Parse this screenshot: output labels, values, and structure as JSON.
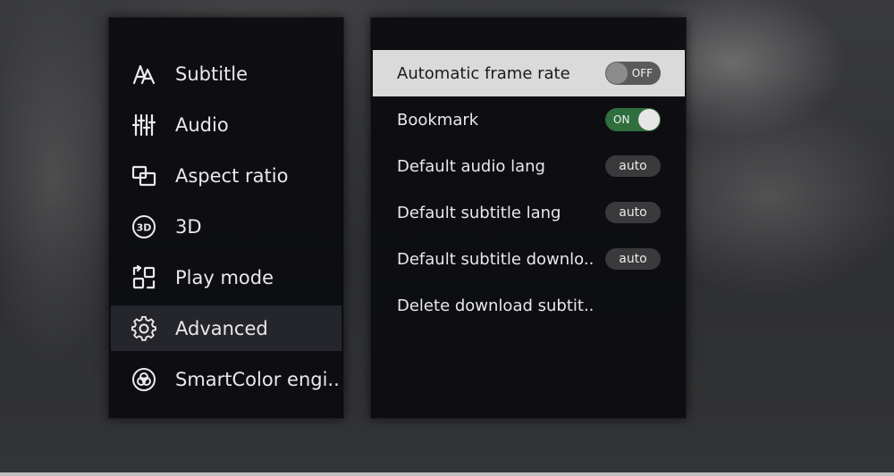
{
  "menu": {
    "items": [
      {
        "label": "Subtitle",
        "icon": "subtitle-icon"
      },
      {
        "label": "Audio",
        "icon": "audio-sliders-icon"
      },
      {
        "label": "Aspect ratio",
        "icon": "aspect-ratio-icon"
      },
      {
        "label": "3D",
        "icon": "3d-icon"
      },
      {
        "label": "Play mode",
        "icon": "play-mode-icon"
      },
      {
        "label": "Advanced",
        "icon": "gear-icon",
        "active": true
      },
      {
        "label": "SmartColor engi..",
        "icon": "smartcolor-icon"
      }
    ]
  },
  "settings": {
    "items": [
      {
        "label": "Automatic frame rate",
        "control": "toggle",
        "value": "OFF"
      },
      {
        "label": "Bookmark",
        "control": "toggle",
        "value": "ON"
      },
      {
        "label": "Default audio lang",
        "control": "pill",
        "value": "auto"
      },
      {
        "label": "Default subtitle lang",
        "control": "pill",
        "value": "auto"
      },
      {
        "label": "Default subtitle downlo..",
        "control": "pill",
        "value": "auto"
      },
      {
        "label": "Delete download subtit..",
        "control": "none"
      }
    ]
  },
  "colors": {
    "panel_bg": "#0c0c10",
    "active_item_bg": "#25262b",
    "highlight_row_bg": "#dadada",
    "toggle_on": "#2f6e3d",
    "toggle_off": "#5a5a5a"
  }
}
